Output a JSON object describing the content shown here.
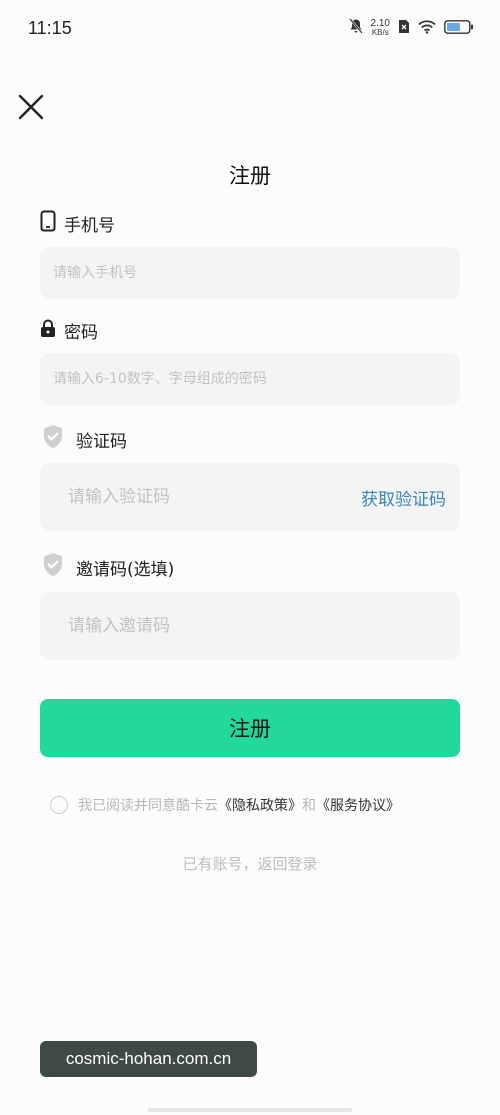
{
  "status_bar": {
    "time": "11:15",
    "net_speed_value": "2.10",
    "net_speed_unit": "KB/s",
    "icons": [
      "mute-bell-icon",
      "no-sim-icon",
      "wifi-icon",
      "battery-icon"
    ]
  },
  "page": {
    "title": "注册",
    "close_icon": "close-icon"
  },
  "form": {
    "phone": {
      "label": "手机号",
      "icon": "phone-icon",
      "placeholder": "请输入手机号",
      "value": ""
    },
    "password": {
      "label": "密码",
      "icon": "lock-icon",
      "placeholder": "请输入6-10数字、字母组成的密码",
      "value": ""
    },
    "code": {
      "label": "验证码",
      "icon": "shield-check-icon",
      "placeholder": "请输入验证码",
      "value": "",
      "get_code_label": "获取验证码"
    },
    "invite": {
      "label": "邀请码(选填)",
      "icon": "shield-check-icon",
      "placeholder": "请输入邀请码",
      "value": ""
    }
  },
  "actions": {
    "register_label": "注册",
    "agreement_prefix": "我已阅读并同意酷卡云",
    "privacy_link": "《隐私政策》",
    "agreement_and": "和",
    "service_link": "《服务协议》",
    "agreement_checked": false,
    "back_login": "已有账号，返回登录"
  },
  "watermark": "cosmic-hohan.com.cn",
  "colors": {
    "accent": "#22d89b",
    "link": "#3a86b8",
    "input_bg": "#f4f4f4",
    "page_bg": "#fcfcfc"
  }
}
